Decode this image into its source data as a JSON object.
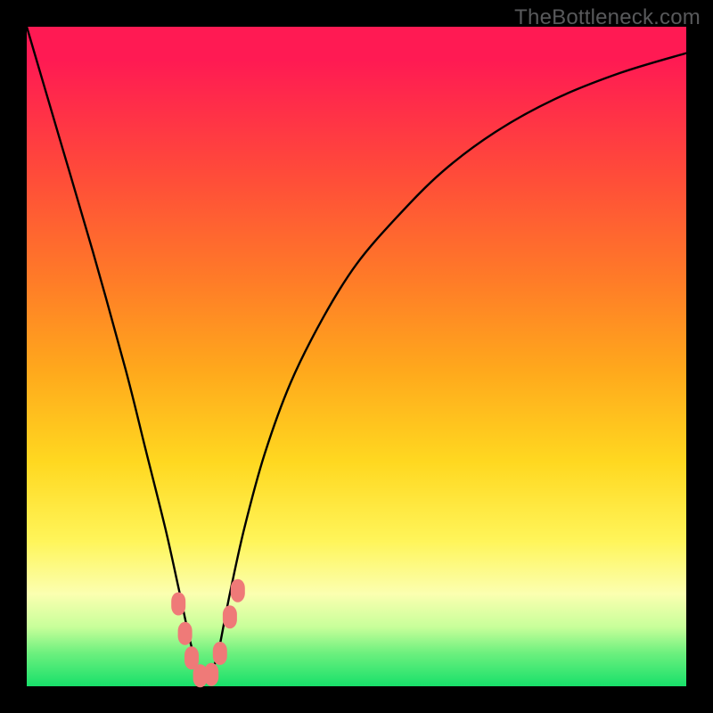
{
  "watermark": "TheBottleneck.com",
  "chart_data": {
    "type": "line",
    "title": "",
    "xlabel": "",
    "ylabel": "",
    "xlim": [
      0,
      100
    ],
    "ylim": [
      0,
      100
    ],
    "x": [
      0,
      5,
      10,
      15,
      18,
      21,
      23,
      24.5,
      25.5,
      26,
      26.5,
      27,
      27.5,
      28,
      29,
      30,
      31,
      33,
      36,
      40,
      45,
      50,
      56,
      63,
      71,
      80,
      90,
      100
    ],
    "y": [
      100,
      83,
      66,
      48,
      36,
      24,
      15,
      8,
      4,
      2,
      1,
      0.6,
      1,
      2,
      5,
      10,
      15,
      24,
      35,
      46,
      56,
      64,
      71,
      78,
      84,
      89,
      93,
      96
    ],
    "annotations": [
      {
        "x": 23.0,
        "y": 12.5,
        "kind": "marker"
      },
      {
        "x": 24.0,
        "y": 8.0,
        "kind": "marker"
      },
      {
        "x": 25.0,
        "y": 4.3,
        "kind": "marker"
      },
      {
        "x": 26.3,
        "y": 1.6,
        "kind": "marker"
      },
      {
        "x": 28.0,
        "y": 1.8,
        "kind": "marker"
      },
      {
        "x": 29.3,
        "y": 5.0,
        "kind": "marker"
      },
      {
        "x": 30.8,
        "y": 10.5,
        "kind": "marker"
      },
      {
        "x": 32.0,
        "y": 14.5,
        "kind": "marker"
      }
    ],
    "gradient_bands": [
      {
        "color": "#ff1a53",
        "level": 100
      },
      {
        "color": "#ff7a28",
        "level": 60
      },
      {
        "color": "#ffd820",
        "level": 30
      },
      {
        "color": "#fff55a",
        "level": 18
      },
      {
        "color": "#6cf07e",
        "level": 6
      },
      {
        "color": "#18e06a",
        "level": 0
      }
    ]
  }
}
